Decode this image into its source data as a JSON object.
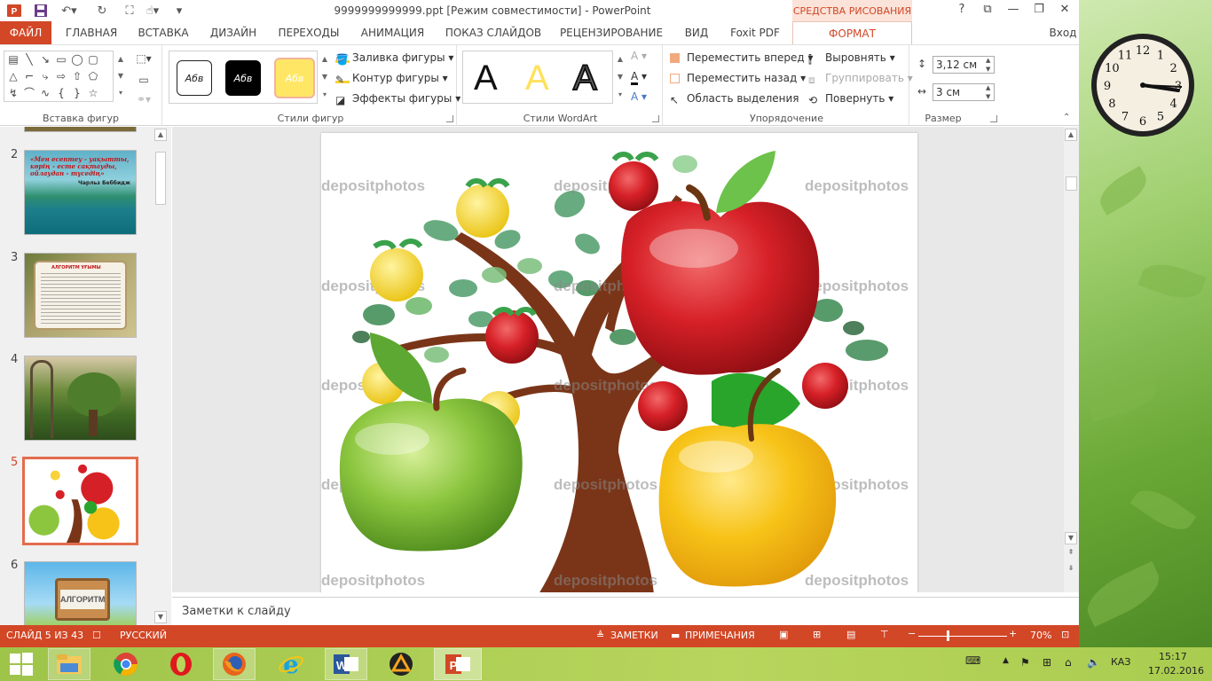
{
  "window": {
    "title": "9999999999999.ppt [Режим совместимости] - PowerPoint",
    "context_header": "СРЕДСТВА РИСОВАНИЯ",
    "help": "?",
    "signin": "Вход"
  },
  "tabs": [
    "ФАЙЛ",
    "ГЛАВНАЯ",
    "ВСТАВКА",
    "ДИЗАЙН",
    "ПЕРЕХОДЫ",
    "АНИМАЦИЯ",
    "ПОКАЗ СЛАЙДОВ",
    "РЕЦЕНЗИРОВАНИЕ",
    "ВИД",
    "Foxit PDF",
    "ФОРМАТ"
  ],
  "ribbon": {
    "insert_shapes": {
      "label": "Вставка фигур"
    },
    "shape_styles": {
      "label": "Стили фигур",
      "previews": [
        "Абв",
        "Абв",
        "Абв"
      ],
      "fill": "Заливка фигуры",
      "outline": "Контур фигуры",
      "effects": "Эффекты фигуры"
    },
    "wordart": {
      "label": "Стили WordArt",
      "glyphs": [
        "A",
        "A",
        "A",
        "A",
        "A",
        "A"
      ]
    },
    "arrange": {
      "label": "Упорядочение",
      "bring_forward": "Переместить вперед",
      "send_backward": "Переместить назад",
      "selection_pane": "Область выделения",
      "align": "Выровнять",
      "group": "Группировать",
      "rotate": "Повернуть"
    },
    "size": {
      "label": "Размер",
      "height": "3,12 см",
      "width": "3 см"
    }
  },
  "slides": [
    {
      "num": "2"
    },
    {
      "num": "3"
    },
    {
      "num": "4"
    },
    {
      "num": "5",
      "selected": true
    },
    {
      "num": "6"
    }
  ],
  "thumb_texts": {
    "s2_quote": "«Мен есептеу - уақытты, көрің - есте сақтауды, ойлаудан - тұседің»",
    "s2_author": "Чарльз Беббидж",
    "s3_title": "АЛГОРИТМ ҰҒЫМЫ",
    "s6_sign": "АЛГОРИТМ"
  },
  "watermark": "depositphotos",
  "notes": {
    "placeholder": "Заметки к слайду"
  },
  "status": {
    "slide": "СЛАЙД 5 ИЗ 43",
    "language": "РУССКИЙ",
    "notes": "ЗАМЕТКИ",
    "comments": "ПРИМЕЧАНИЯ",
    "zoom": "70%"
  },
  "taskbar": {
    "lang": "КАЗ",
    "time": "15:17",
    "date": "17.02.2016",
    "apps": [
      "file-explorer",
      "chrome",
      "opera",
      "firefox",
      "internet-explorer",
      "word",
      "artisteer",
      "powerpoint"
    ]
  },
  "clock_numbers": [
    "12",
    "1",
    "2",
    "3",
    "4",
    "5",
    "6",
    "7",
    "8",
    "9",
    "10",
    "11"
  ],
  "colors": {
    "accent": "#d24726",
    "apple_red": "#d62027",
    "apple_green": "#8cc63f",
    "apple_yellow": "#f7c318",
    "trunk": "#7a3518"
  }
}
